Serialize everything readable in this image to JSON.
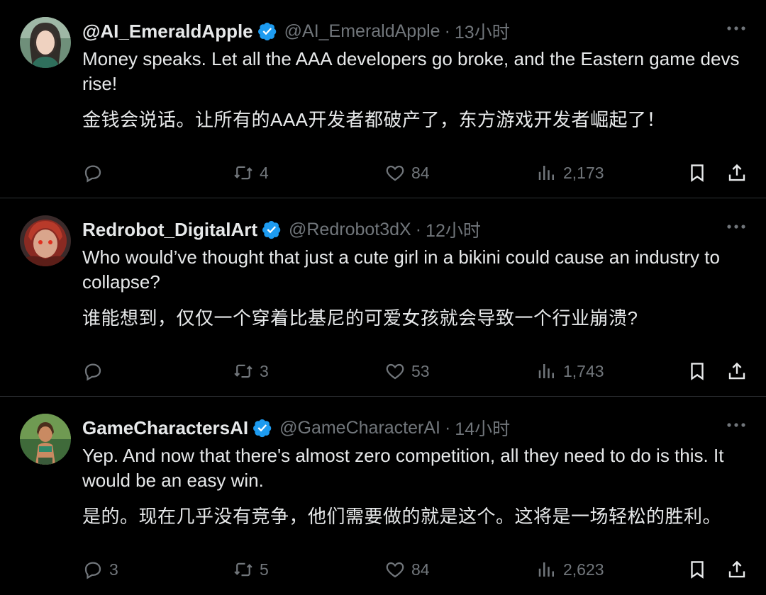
{
  "tweets": [
    {
      "name": "@AI_EmeraldApple",
      "handle": "@AI_EmeraldApple",
      "time": "13小时",
      "text_en": "Money speaks. Let all the AAA developers go broke, and the Eastern game devs rise!",
      "text_zh": "金钱会说话。让所有的AAA开发者都破产了，东方游戏开发者崛起了！",
      "replies": "",
      "retweets": "4",
      "likes": "84",
      "views": "2,173"
    },
    {
      "name": "Redrobot_DigitalArt",
      "handle": "@Redrobot3dX",
      "time": "12小时",
      "text_en": "Who would’ve thought that just a cute girl in a bikini could cause an industry to collapse?",
      "text_zh": "谁能想到，仅仅一个穿着比基尼的可爱女孩就会导致一个行业崩溃?",
      "replies": "",
      "retweets": "3",
      "likes": "53",
      "views": "1,743"
    },
    {
      "name": "GameCharactersAI",
      "handle": "@GameCharacterAI",
      "time": "14小时",
      "text_en": "Yep. And now that there's almost zero competition, all they need to do is this. It would be an easy win.",
      "text_zh": "是的。现在几乎没有竞争，他们需要做的就是这个。这将是一场轻松的胜利。",
      "replies": "3",
      "retweets": "5",
      "likes": "84",
      "views": "2,623"
    }
  ],
  "separator": "·",
  "icons": {
    "verified": "verified-badge-icon",
    "more": "more-icon",
    "reply": "reply-icon",
    "retweet": "retweet-icon",
    "like": "like-icon",
    "views": "views-icon",
    "bookmark": "bookmark-icon",
    "share": "share-icon"
  },
  "colors": {
    "background": "#000000",
    "text": "#e7e9ea",
    "muted": "#71767b",
    "verified": "#1d9bf0",
    "divider": "#2f3336"
  }
}
